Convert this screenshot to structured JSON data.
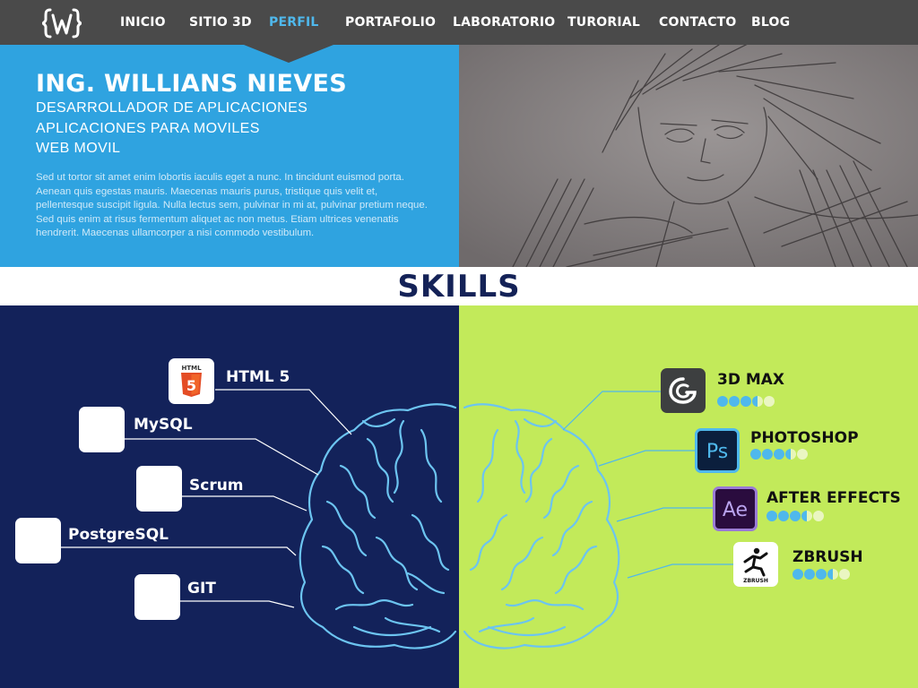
{
  "nav": {
    "logo": "{W}",
    "items": [
      {
        "label": "INICIO",
        "active": false
      },
      {
        "label": "SITIO 3D",
        "active": false
      },
      {
        "label": "PERFIL",
        "active": true
      },
      {
        "label": "PORTAFOLIO",
        "active": false
      },
      {
        "label": "LABORATORIO",
        "active": false
      },
      {
        "label": "TURORIAL",
        "active": false
      },
      {
        "label": "CONTACTO",
        "active": false
      },
      {
        "label": "BLOG",
        "active": false
      }
    ]
  },
  "profile": {
    "name": "ING. WILLIANS NIEVES",
    "roles": [
      "DESARROLLADOR DE APLICACIONES",
      "APLICACIONES PARA  MOVILES",
      "WEB MOVIL"
    ],
    "description": "Sed ut tortor sit amet enim lobortis iaculis eget a nunc. In tincidunt euismod porta. Aenean quis egestas mauris. Maecenas mauris purus, tristique quis velit et, pellentesque suscipit ligula. Nulla lectus sem, pulvinar in mi at, pulvinar pretium neque. Sed quis enim at risus fermentum aliquet ac non metus. Etiam ultrices venenatis hendrerit. Maecenas ullamcorper a nisi commodo vestibulum."
  },
  "skills": {
    "title": "SKILLS",
    "technical": [
      {
        "name": "HTML 5",
        "icon": "html5-icon",
        "icon_text": "HTML"
      },
      {
        "name": "MySQL",
        "icon": "mysql-icon"
      },
      {
        "name": "Scrum",
        "icon": "scrum-icon"
      },
      {
        "name": "PostgreSQL",
        "icon": "postgresql-icon"
      },
      {
        "name": "GIT",
        "icon": "git-icon"
      }
    ],
    "software": [
      {
        "name": "3D MAX",
        "icon": "3dsmax-icon",
        "rating": 3.5
      },
      {
        "name": "PHOTOSHOP",
        "icon": "photoshop-icon",
        "icon_text": "Ps",
        "rating": 3.5
      },
      {
        "name": "AFTER EFFECTS",
        "icon": "after-effects-icon",
        "icon_text": "Ae",
        "rating": 3.5
      },
      {
        "name": "ZBRUSH",
        "icon": "zbrush-icon",
        "icon_text": "ZBRUSH",
        "rating": 3.5
      }
    ],
    "rating_max": 5
  },
  "colors": {
    "nav_bg": "#4a4a4a",
    "nav_active": "#4fb8ec",
    "hero_blue": "#2fa3e0",
    "navy": "#13225a",
    "lime": "#c2ea5a",
    "brain_stroke": "#6cc4f0"
  }
}
